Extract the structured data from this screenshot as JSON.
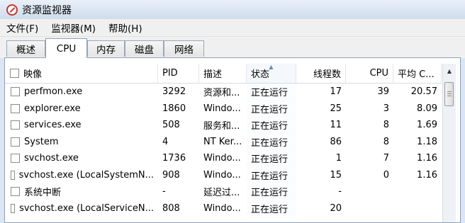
{
  "window": {
    "title": "资源监视器"
  },
  "menu": [
    "文件(F)",
    "监视器(M)",
    "帮助(H)"
  ],
  "tabs": [
    "概述",
    "CPU",
    "内存",
    "磁盘",
    "网络"
  ],
  "active_tab": "CPU",
  "table": {
    "columns": [
      "映像",
      "PID",
      "描述",
      "状态",
      "线程数",
      "CPU",
      "平均 C..."
    ],
    "sorted_column": "状态",
    "rows": [
      [
        "perfmon.exe",
        "3292",
        "资源和...",
        "正在运行",
        "17",
        "39",
        "20.57"
      ],
      [
        "explorer.exe",
        "1860",
        "Windo...",
        "正在运行",
        "25",
        "3",
        "8.09"
      ],
      [
        "services.exe",
        "508",
        "服务和...",
        "正在运行",
        "11",
        "8",
        "1.69"
      ],
      [
        "System",
        "4",
        "NT Ker...",
        "正在运行",
        "86",
        "8",
        "1.18"
      ],
      [
        "svchost.exe",
        "1736",
        "Windo...",
        "正在运行",
        "1",
        "7",
        "1.16"
      ],
      [
        "svchost.exe (LocalSystemN...",
        "908",
        "Windo...",
        "正在运行",
        "15",
        "0",
        "1.16"
      ],
      [
        "系统中断",
        "-",
        "延迟过...",
        "正在运行",
        "-",
        "",
        ""
      ],
      [
        "svchost.exe (LocalServiceN...",
        "808",
        "Windo...",
        "正在运行",
        "20",
        "",
        ""
      ]
    ]
  }
}
